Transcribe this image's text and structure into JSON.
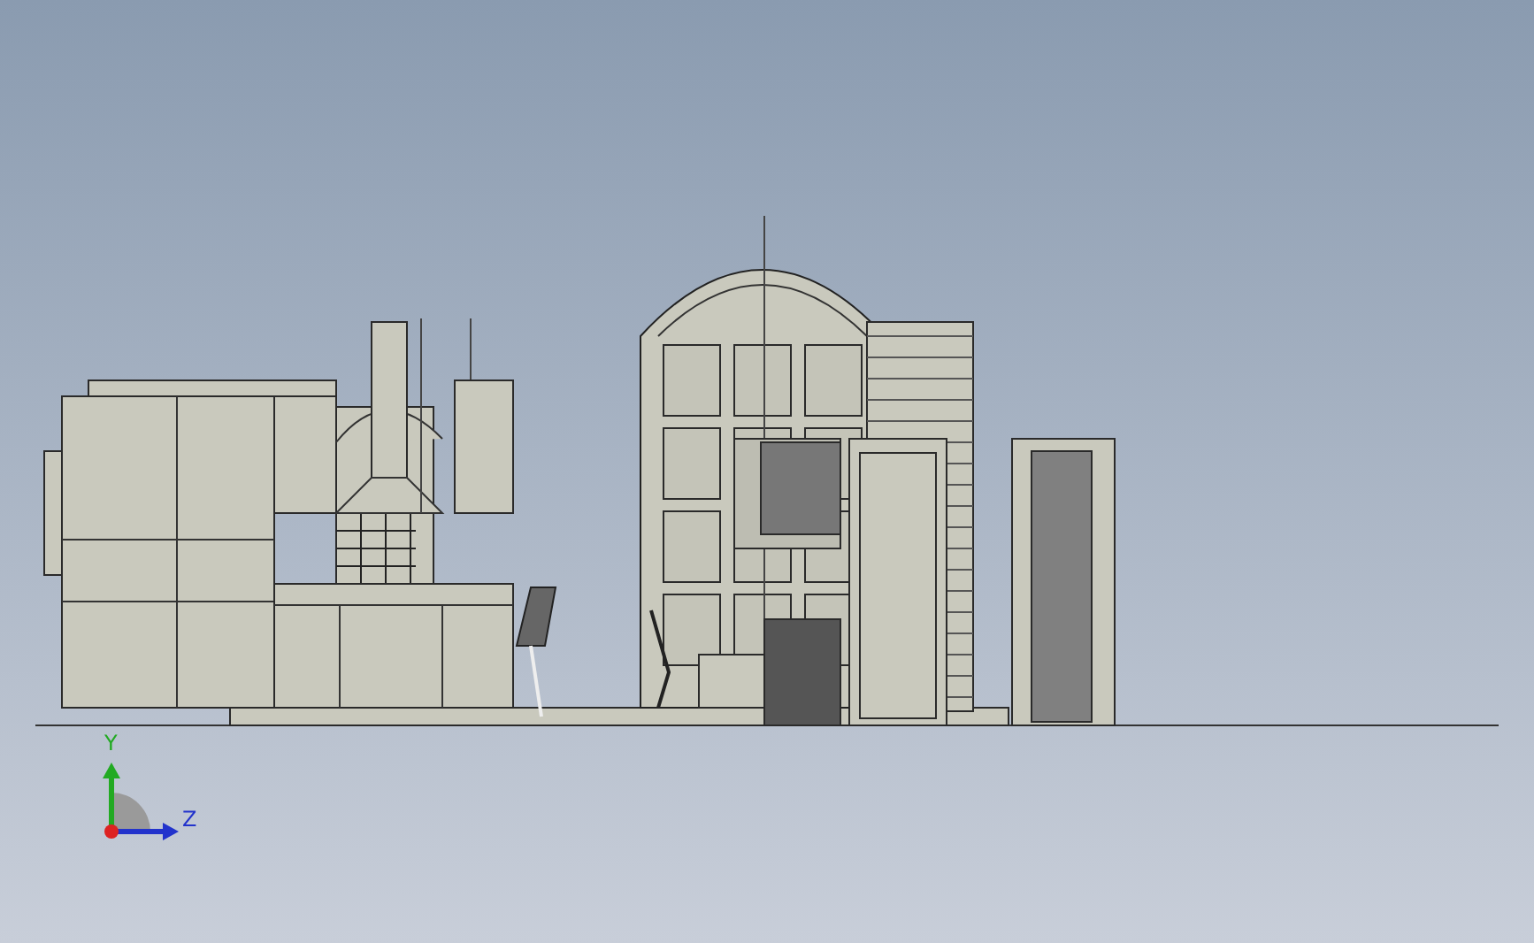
{
  "viewport": {
    "axes": [
      {
        "label": "Y",
        "color": "#22aa22"
      },
      {
        "label": "Z",
        "color": "#2233cc"
      }
    ]
  }
}
